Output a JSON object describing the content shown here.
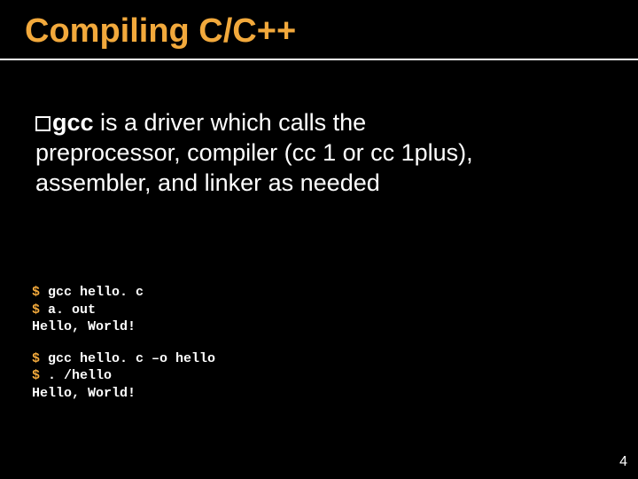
{
  "title": "Compiling C/C++",
  "bullet": {
    "gcc": "gcc",
    "rest_line1": " is a driver which calls the",
    "line2": "preprocessor, compiler (cc 1 or cc 1plus),",
    "line3": "assembler, and linker as needed"
  },
  "terminal": {
    "group1": {
      "l1_prompt": "$",
      "l1_cmd": " gcc hello. c",
      "l2_prompt": "$",
      "l2_cmd": " a. out",
      "l3": "Hello, World!"
    },
    "group2": {
      "l1_prompt": "$",
      "l1_cmd": " gcc hello. c –o hello",
      "l2_prompt": "$",
      "l2_cmd": " . /hello",
      "l3": "Hello, World!"
    }
  },
  "page_number": "4"
}
